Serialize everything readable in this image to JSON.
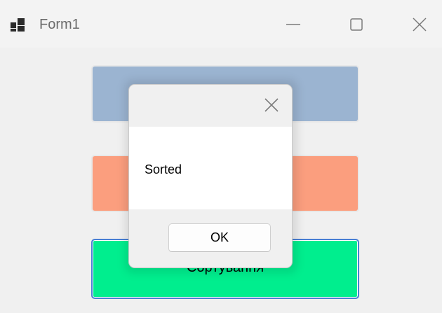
{
  "window": {
    "title": "Form1",
    "controls": {
      "minimize": "minimize-icon",
      "maximize": "maximize-icon",
      "close": "close-icon"
    }
  },
  "form": {
    "buttons": [
      {
        "label": "",
        "color": "#9bb4d1"
      },
      {
        "label": "",
        "color": "#fb9e7e"
      },
      {
        "label": "Сортування",
        "color": "#00ee8e"
      }
    ]
  },
  "dialog": {
    "message": "Sorted",
    "ok_label": "OK",
    "close_icon": "close-icon"
  },
  "colors": {
    "focus_border": "#4a7fd4",
    "window_bg": "#f0f0f0"
  }
}
